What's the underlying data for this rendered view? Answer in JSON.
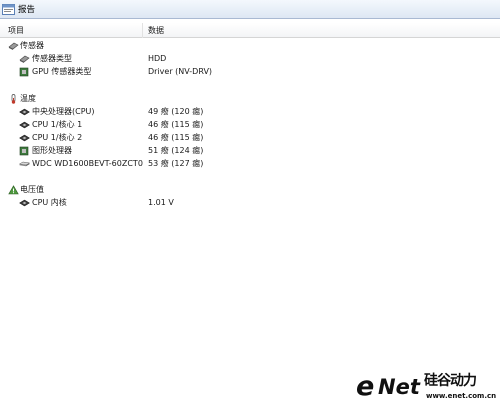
{
  "window": {
    "title": "报告"
  },
  "columns": {
    "item": "项目",
    "data": "数据"
  },
  "groups": {
    "sensor": {
      "label": "传感器",
      "icon": "sensor-icon",
      "rows": [
        {
          "label": "传感器类型",
          "value": "HDD",
          "icon": "sensor-icon"
        },
        {
          "label": "GPU 传感器类型",
          "value": "Driver (NV-DRV)",
          "icon": "gpu-chip-icon"
        }
      ]
    },
    "temperature": {
      "label": "温度",
      "icon": "thermometer-icon",
      "rows": [
        {
          "label": "中央处理器(CPU)",
          "value": "49 癈 (120 癋)",
          "icon": "cpu-chip-icon"
        },
        {
          "label": "CPU 1/核心 1",
          "value": "46 癈 (115 癋)",
          "icon": "cpu-chip-icon"
        },
        {
          "label": "CPU 1/核心 2",
          "value": "46 癈 (115 癋)",
          "icon": "cpu-chip-icon"
        },
        {
          "label": "图形处理器",
          "value": "51 癈 (124 癋)",
          "icon": "gpu-chip-icon"
        },
        {
          "label": "WDC WD1600BEVT-60ZCT0",
          "value": "53 癈 (127 癋)",
          "icon": "hard-disk-icon"
        }
      ]
    },
    "voltage": {
      "label": "电压值",
      "icon": "voltage-icon",
      "rows": [
        {
          "label": "CPU 内核",
          "value": "1.01 V",
          "icon": "cpu-chip-icon"
        }
      ]
    }
  },
  "watermark": {
    "e": "e",
    "net": "Net",
    "cn": "硅谷动力",
    "domain": "www.enet.com.cn"
  }
}
